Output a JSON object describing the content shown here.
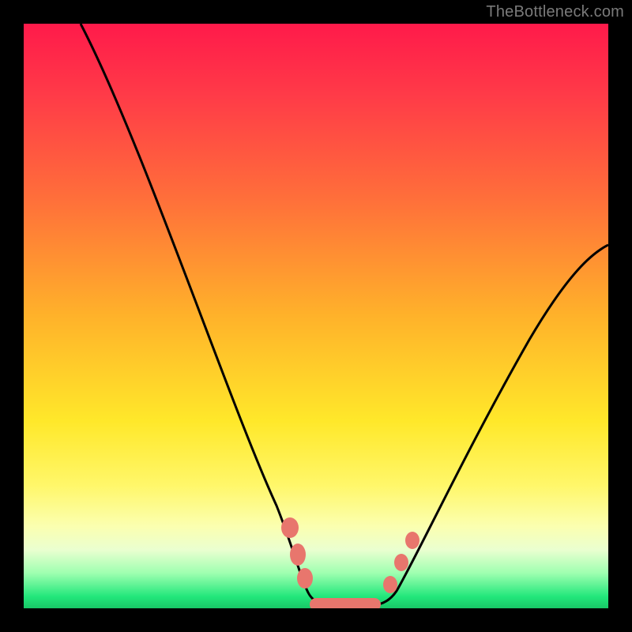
{
  "watermark": "TheBottleneck.com",
  "chart_data": {
    "type": "line",
    "title": "",
    "xlabel": "",
    "ylabel": "",
    "xlim": [
      0,
      100
    ],
    "ylim": [
      0,
      100
    ],
    "grid": false,
    "legend": false,
    "series": [
      {
        "name": "bottleneck-curve",
        "x": [
          10,
          15,
          20,
          25,
          30,
          35,
          40,
          43,
          46,
          49,
          52,
          55,
          58,
          62,
          66,
          70,
          75,
          80,
          85,
          90,
          95,
          100
        ],
        "values": [
          100,
          88,
          76,
          64,
          52,
          40,
          28,
          18,
          10,
          4,
          1,
          0,
          0,
          1,
          4,
          9,
          17,
          26,
          35,
          44,
          53,
          62
        ]
      }
    ],
    "markers": [
      {
        "x": 43,
        "y": 18
      },
      {
        "x": 45,
        "y": 11
      },
      {
        "x": 46,
        "y": 8
      },
      {
        "x": 62,
        "y": 5
      },
      {
        "x": 64,
        "y": 9
      },
      {
        "x": 66,
        "y": 13
      }
    ],
    "floor_segment": {
      "x_start": 48,
      "x_end": 60,
      "y": 0.5
    },
    "gradient_bands": [
      {
        "color": "#ff1a4a",
        "y": 100
      },
      {
        "color": "#ffb22a",
        "y": 50
      },
      {
        "color": "#ffe82a",
        "y": 32
      },
      {
        "color": "#22e77b",
        "y": 2
      }
    ]
  }
}
